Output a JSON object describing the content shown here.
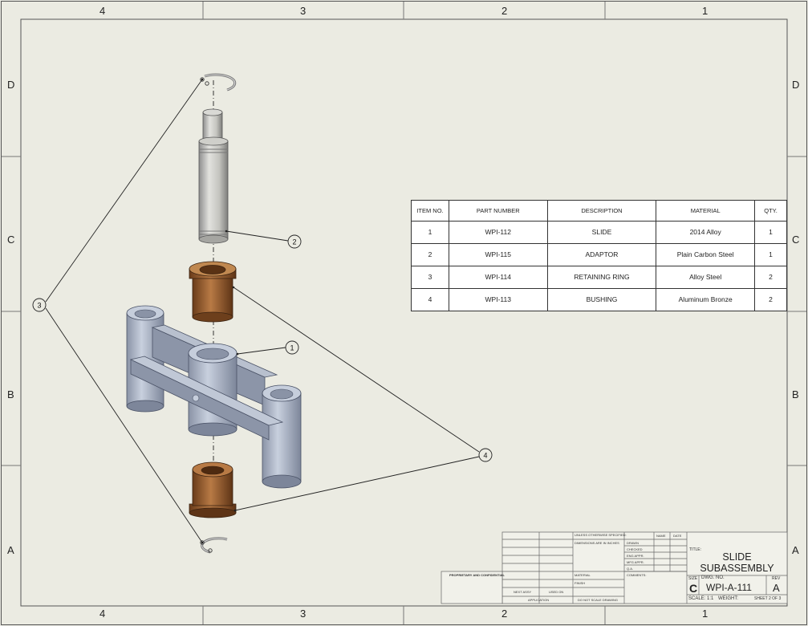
{
  "border_zones": {
    "columns": [
      "4",
      "3",
      "2",
      "1"
    ],
    "rows": [
      "D",
      "C",
      "B",
      "A"
    ]
  },
  "bom": {
    "headers": [
      "ITEM NO.",
      "PART NUMBER",
      "DESCRIPTION",
      "MATERIAL",
      "QTY."
    ],
    "rows": [
      [
        "1",
        "WPI-112",
        "SLIDE",
        "2014 Alloy",
        "1"
      ],
      [
        "2",
        "WPI-115",
        "ADAPTOR",
        "Plain Carbon Steel",
        "1"
      ],
      [
        "3",
        "WPI-114",
        "RETAINING RING",
        "Alloy Steel",
        "2"
      ],
      [
        "4",
        "WPI-113",
        "BUSHING",
        "Aluminum Bronze",
        "2"
      ]
    ]
  },
  "balloons": {
    "b1": "1",
    "b2": "2",
    "b3": "3",
    "b4": "4"
  },
  "title_block": {
    "title_label": "TITLE:",
    "title_line1": "SLIDE",
    "title_line2": "SUBASSEMBLY",
    "size_label": "SIZE",
    "size": "C",
    "dwg_no_label": "DWG. NO.",
    "dwg_no": "WPI-A-111",
    "rev_label": "REV",
    "rev": "A",
    "scale": "SCALE: 1:1",
    "weight": "WEIGHT:",
    "sheet": "SHEET 2 OF 3",
    "unless": "UNLESS OTHERWISE SPECIFIED:",
    "name": "NAME",
    "date": "DATE",
    "dims": "DIMENSIONS ARE IN INCHES",
    "drawn": "DRAWN",
    "checked": "CHECKED",
    "eng_appr": "ENG APPR.",
    "mfg_appr": "MFG APPR.",
    "qa": "Q.A.",
    "comments": "COMMENTS:",
    "material": "MATERIAL",
    "finish": "FINISH",
    "next_assy": "NEXT ASSY",
    "used_on": "USED ON",
    "application": "APPLICATION",
    "do_not_scale": "DO NOT SCALE DRAWING",
    "proprietary": "PROPRIETARY AND CONFIDENTIAL"
  }
}
